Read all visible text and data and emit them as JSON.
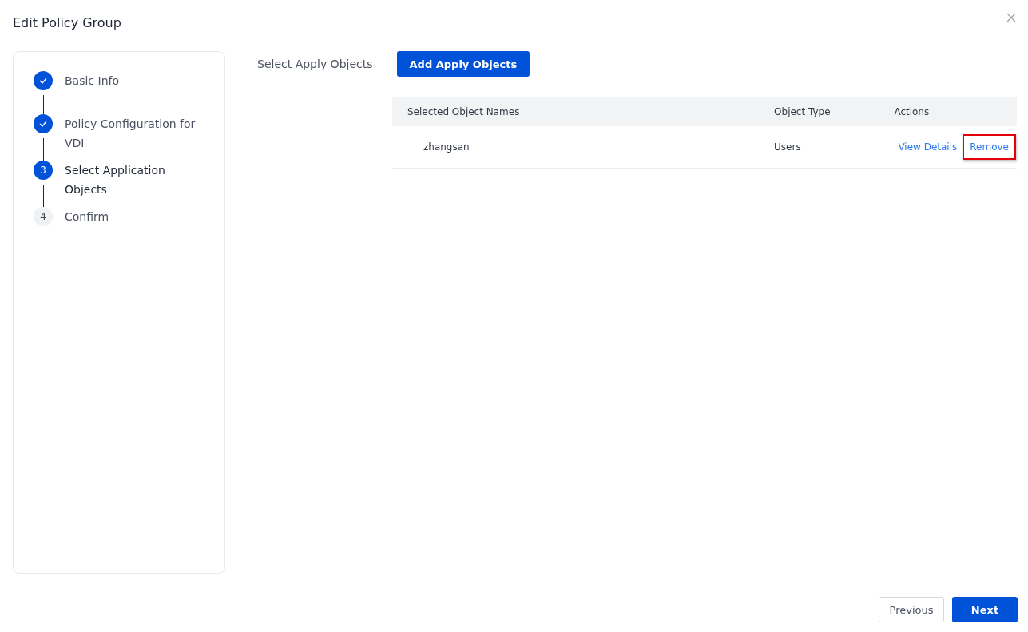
{
  "dialog": {
    "title": "Edit Policy Group"
  },
  "steps": [
    {
      "label": "Basic Info",
      "completed": true,
      "active": false
    },
    {
      "label": "Policy Configuration for VDI",
      "completed": true,
      "active": false
    },
    {
      "number": "3",
      "label": "Select Application Objects",
      "completed": false,
      "active": true
    },
    {
      "number": "4",
      "label": "Confirm",
      "completed": false,
      "active": false
    }
  ],
  "form": {
    "label": "Select Apply Objects",
    "add_button": "Add Apply Objects"
  },
  "table": {
    "columns": [
      "Selected Object Names",
      "Object Type",
      "Actions"
    ],
    "rows": [
      {
        "name": "zhangsan",
        "type": "Users",
        "actions": [
          {
            "label": "View Details",
            "highlighted": false
          },
          {
            "label": "Remove",
            "highlighted": true
          }
        ]
      }
    ]
  },
  "footer": {
    "buttons": [
      {
        "label": "Previous",
        "kind": "secondary"
      },
      {
        "label": "Next",
        "kind": "primary"
      }
    ]
  }
}
